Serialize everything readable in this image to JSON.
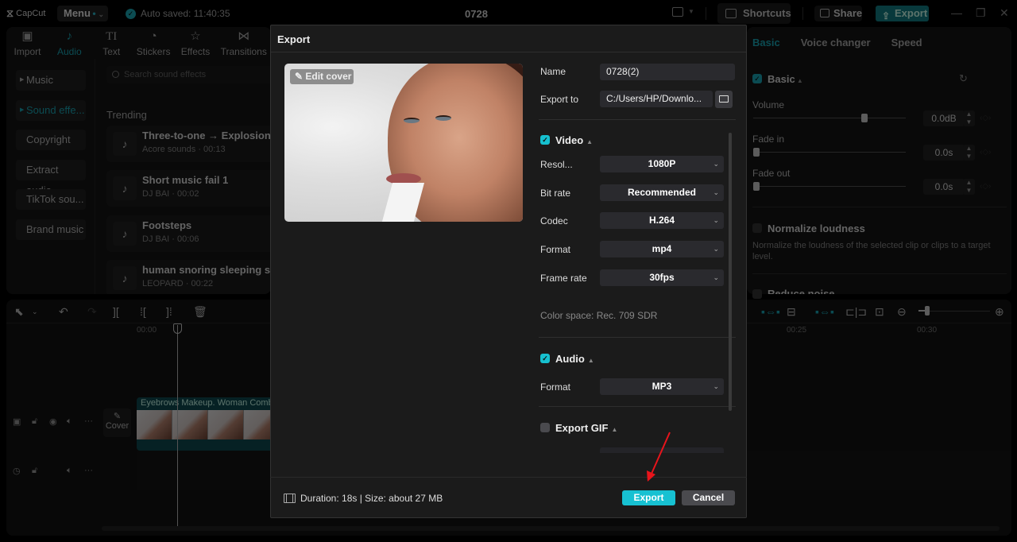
{
  "app": {
    "logo": "CapCut",
    "menu_label": "Menu",
    "autosave": "Auto saved: 11:40:35",
    "project_title": "0728",
    "shortcuts_label": "Shortcuts",
    "share_label": "Share",
    "export_label": "Export"
  },
  "left_panel": {
    "tabs": [
      {
        "label": "Import",
        "icon": "import-icon"
      },
      {
        "label": "Audio",
        "icon": "audio-icon",
        "active": true
      },
      {
        "label": "Text",
        "icon": "text-icon"
      },
      {
        "label": "Stickers",
        "icon": "sticker-icon"
      },
      {
        "label": "Effects",
        "icon": "effects-icon"
      },
      {
        "label": "Transitions",
        "icon": "transitions-icon"
      }
    ],
    "nav": [
      {
        "label": "Music"
      },
      {
        "label": "Sound effe...",
        "active": true
      },
      {
        "label": "Copyright"
      },
      {
        "label": "Extract audio"
      },
      {
        "label": "TikTok sou..."
      },
      {
        "label": "Brand music"
      }
    ],
    "search_placeholder": "Search sound effects",
    "trending_label": "Trending",
    "sounds": [
      {
        "title": "Three-to-one → Explosion s",
        "subtitle": "Acore sounds · 00:13"
      },
      {
        "title": "Short music fail 1",
        "subtitle": "DJ BAI · 00:02"
      },
      {
        "title": "Footsteps",
        "subtitle": "DJ BAI · 00:06"
      },
      {
        "title": "human snoring sleeping sou",
        "subtitle": "LEOPARD · 00:22"
      }
    ]
  },
  "right_panel": {
    "tabs": [
      "Basic",
      "Voice changer",
      "Speed"
    ],
    "basic_title": "Basic",
    "volume_label": "Volume",
    "volume_value": "0.0dB",
    "volume_level": 0.73,
    "fade_in_label": "Fade in",
    "fade_in_value": "0.0s",
    "fade_out_label": "Fade out",
    "fade_out_value": "0.0s",
    "normalize_label": "Normalize loudness",
    "normalize_desc": "Normalize the loudness of the selected clip or clips to a target level.",
    "reduce_noise_label": "Reduce noise"
  },
  "timeline": {
    "ticks": [
      "00:00",
      "00:25",
      "00:30"
    ],
    "clip_title": "Eyebrows Makeup. Woman Comb",
    "cover_label": "Cover"
  },
  "dialog": {
    "title": "Export",
    "edit_cover": "Edit cover",
    "name_label": "Name",
    "name_value": "0728(2)",
    "export_to_label": "Export to",
    "export_to_value": "C:/Users/HP/Downlo...",
    "video_title": "Video",
    "video_fields": [
      {
        "label": "Resol...",
        "value": "1080P"
      },
      {
        "label": "Bit rate",
        "value": "Recommended"
      },
      {
        "label": "Codec",
        "value": "H.264"
      },
      {
        "label": "Format",
        "value": "mp4"
      },
      {
        "label": "Frame rate",
        "value": "30fps"
      }
    ],
    "color_space": "Color space: Rec. 709 SDR",
    "audio_title": "Audio",
    "audio_format_label": "Format",
    "audio_format_value": "MP3",
    "gif_title": "Export GIF",
    "footer_info": "Duration: 18s | Size: about 27 MB",
    "export_button": "Export",
    "cancel_button": "Cancel"
  },
  "colors": {
    "accent": "#17c1d2",
    "annotation_arrow": "#e8141b"
  }
}
